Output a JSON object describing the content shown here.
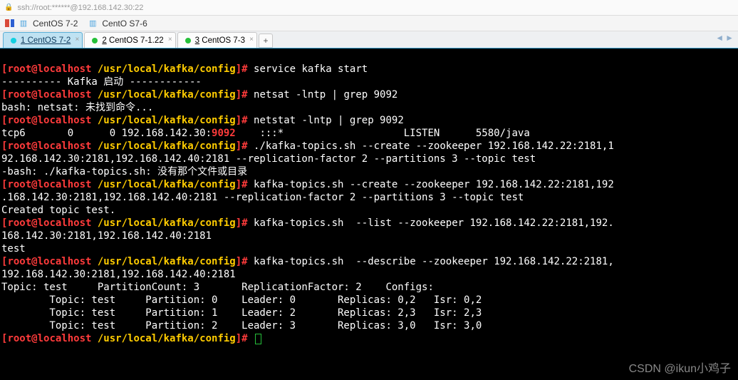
{
  "titlebar": {
    "text": "ssh://root:******@192.168.142.30:22"
  },
  "toolbar": {
    "session1": "CentOS 7-2",
    "session2": "CentO S7-6"
  },
  "tabs": {
    "items": [
      {
        "dot": "cyan",
        "num": "1",
        "label": "CentOS 7-2",
        "active": true
      },
      {
        "dot": "green",
        "num": "2",
        "label": "CentOS 7-1.22",
        "active": false
      },
      {
        "dot": "green",
        "num": "3",
        "label": "CentOS 7-3",
        "active": false
      }
    ],
    "add": "+"
  },
  "prompt": {
    "lb": "[",
    "user": "root@localhost ",
    "path": "/usr/local/kafka/config",
    "rb": "]# "
  },
  "term": {
    "l1_cmd": "service kafka start",
    "l2": "---------- Kafka 启动 ------------",
    "l3_cmd": "netsat -lntp | grep 9092",
    "l4": "bash: netsat: 未找到命令...",
    "l5_cmd": "netstat -lntp | grep 9092",
    "l6_a": "tcp6       0      0 192.168.142.30:",
    "l6_port": "9092",
    "l6_b": "    :::*                    LISTEN      5580/java",
    "l7_cmd": "./kafka-topics.sh --create --zookeeper 192.168.142.22:2181,1",
    "l8": "92.168.142.30:2181,192.168.142.40:2181 --replication-factor 2 --partitions 3 --topic test",
    "l9": "-bash: ./kafka-topics.sh: 没有那个文件或目录",
    "l10_cmd": "kafka-topics.sh --create --zookeeper 192.168.142.22:2181,192",
    "l11": ".168.142.30:2181,192.168.142.40:2181 --replication-factor 2 --partitions 3 --topic test",
    "l12": "Created topic test.",
    "l13_cmd": "kafka-topics.sh  --list --zookeeper 192.168.142.22:2181,192.",
    "l14": "168.142.30:2181,192.168.142.40:2181",
    "l15": "test",
    "l16_cmd": "kafka-topics.sh  --describe --zookeeper 192.168.142.22:2181,",
    "l17": "192.168.142.30:2181,192.168.142.40:2181",
    "l18": "Topic: test     PartitionCount: 3       ReplicationFactor: 2    Configs: ",
    "l19": "        Topic: test     Partition: 0    Leader: 0       Replicas: 0,2   Isr: 0,2",
    "l20": "        Topic: test     Partition: 1    Leader: 2       Replicas: 2,3   Isr: 2,3",
    "l21": "        Topic: test     Partition: 2    Leader: 3       Replicas: 3,0   Isr: 3,0"
  },
  "watermark": "CSDN @ikun小鸡子"
}
